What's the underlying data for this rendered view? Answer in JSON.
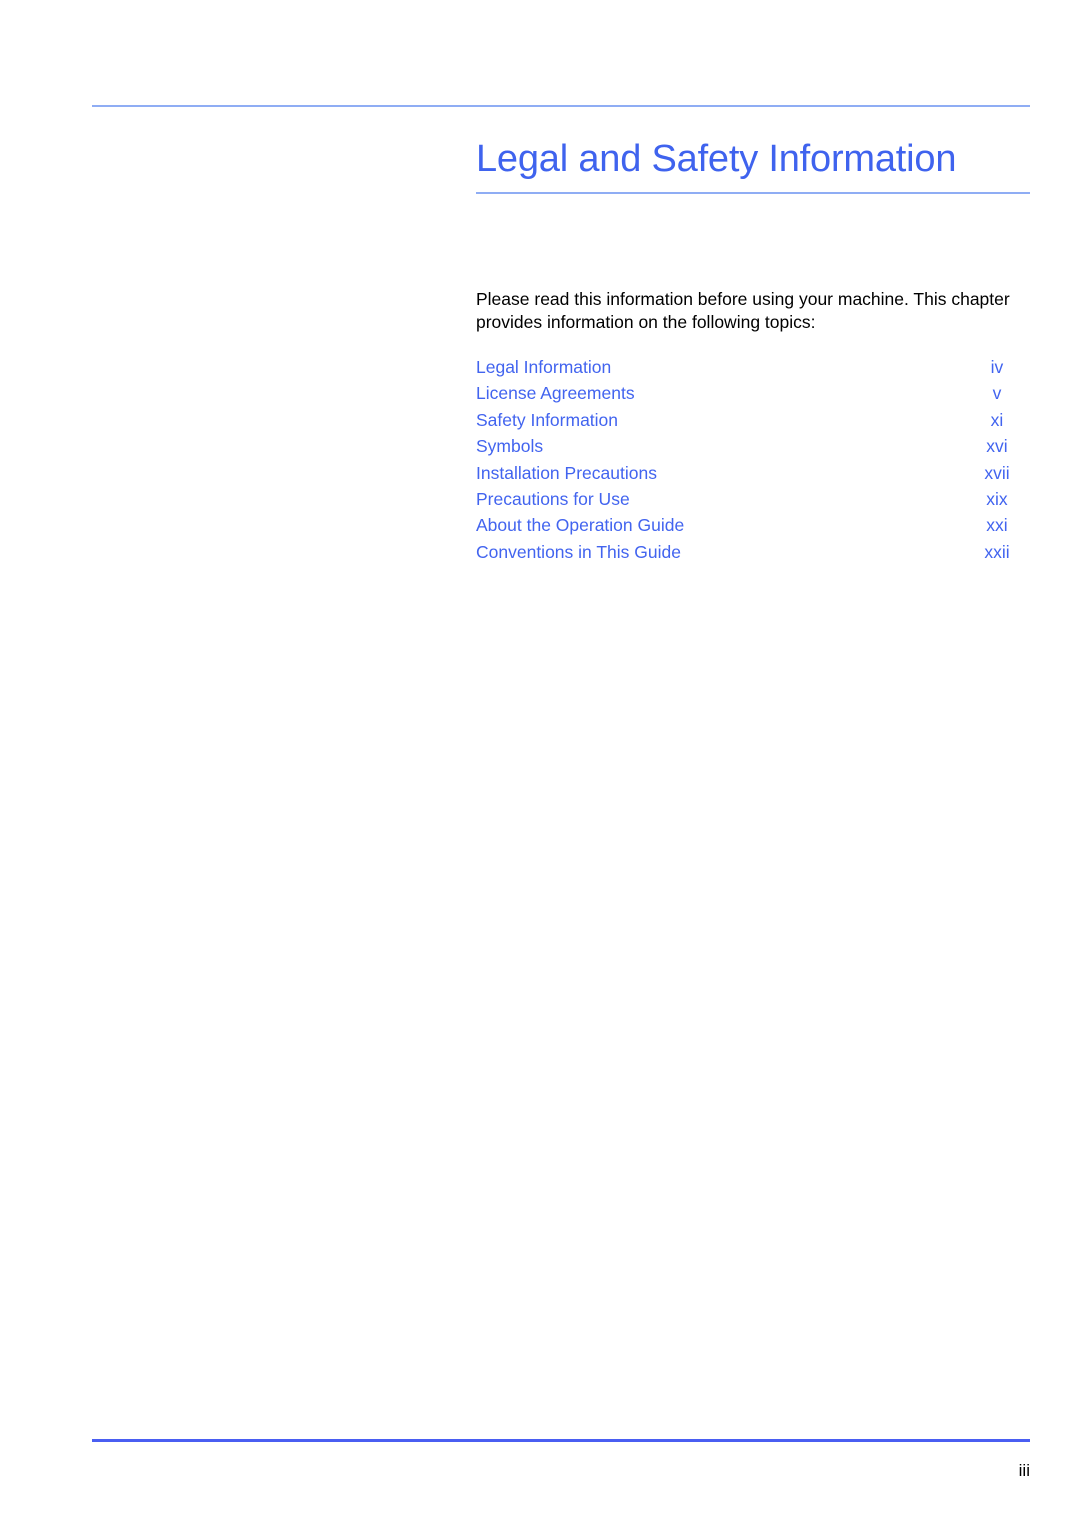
{
  "page": {
    "chapter_title": "Legal and Safety Information",
    "intro_paragraph": "Please read this information before using your machine. This chapter provides information on the following topics:",
    "footer_page_number": "iii"
  },
  "colors": {
    "heading_blue": "#3f63ee",
    "toc_blue": "#4264ef",
    "rule_light_blue": "#8fadf4",
    "rule_footer_blue": "#4a5ef2",
    "body_text": "#000000"
  },
  "toc": {
    "entries": [
      {
        "label": "Legal Information",
        "page": "iv"
      },
      {
        "label": "License Agreements",
        "page": "v"
      },
      {
        "label": "Safety Information",
        "page": "xi"
      },
      {
        "label": "Symbols",
        "page": "xvi"
      },
      {
        "label": "Installation Precautions",
        "page": "xvii"
      },
      {
        "label": "Precautions for Use",
        "page": "xix"
      },
      {
        "label": "About the Operation Guide",
        "page": "xxi"
      },
      {
        "label": "Conventions in This Guide",
        "page": "xxii"
      }
    ]
  }
}
